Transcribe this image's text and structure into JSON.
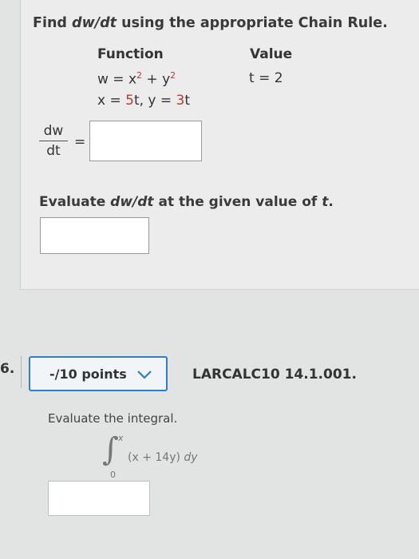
{
  "problem5": {
    "title_pre": "Find",
    "title_var": "dw/dt",
    "title_post": "using the appropriate Chain Rule.",
    "function_header": "Function",
    "value_header": "Value",
    "w_eq": "w = x",
    "w_plus": " + y",
    "exp2": "2",
    "xy_pre": "x = ",
    "x_coef": "5",
    "xy_mid": "t, y = ",
    "y_coef": "3",
    "xy_post": "t",
    "t_value": "t = 2",
    "frac_num": "dw",
    "frac_den": "dt",
    "equals": "=",
    "eval_pre": "Evaluate",
    "eval_var": "dw/dt",
    "eval_mid": "at the given value of",
    "eval_t": "t",
    "eval_end": "."
  },
  "problem6": {
    "number": "6.",
    "points_label": "-/10 points",
    "code": "LARCALC10 14.1.001.",
    "prompt": "Evaluate the integral.",
    "upper_limit": "x",
    "lower_limit": "0",
    "integrand_open": "(x + 14y)",
    "integrand_d": "dy"
  }
}
